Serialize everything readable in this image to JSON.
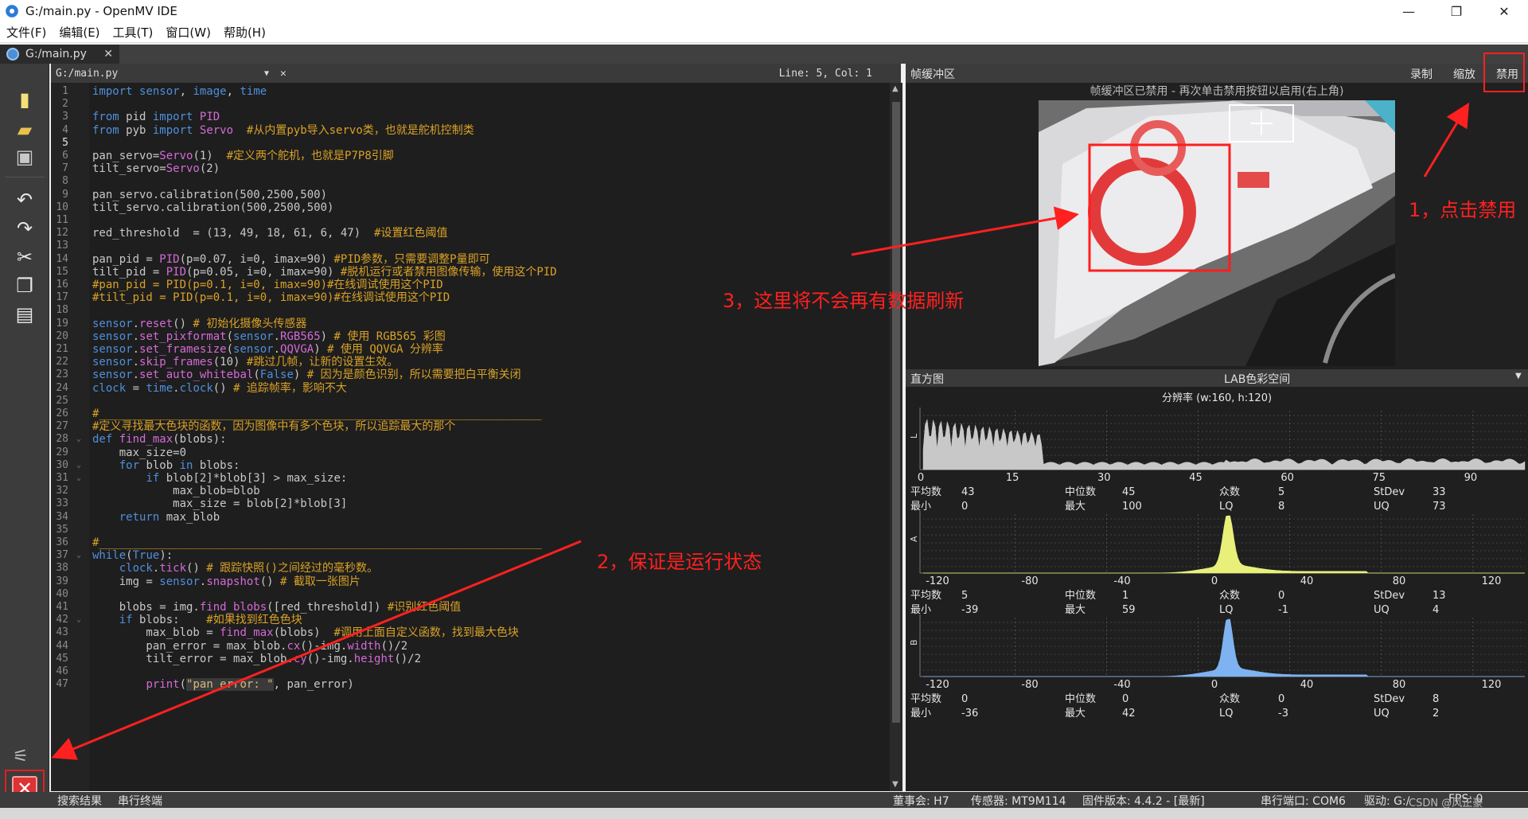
{
  "window": {
    "title": "G:/main.py - OpenMV IDE",
    "minimize": "—",
    "restore": "❐",
    "close": "✕"
  },
  "menu": [
    "文件(F)",
    "编辑(E)",
    "工具(T)",
    "窗口(W)",
    "帮助(H)"
  ],
  "tab": {
    "label": "G:/main.py"
  },
  "editor": {
    "file": "G:/main.py",
    "cursor": "Line: 5, Col: 1",
    "current_line": 5,
    "lines": [
      "import sensor, image, time",
      "",
      "from pid import PID",
      "from pyb import Servo  #从内置pyb导入servo类，也就是舵机控制类",
      "",
      "pan_servo=Servo(1)  #定义两个舵机，也就是P7P8引脚",
      "tilt_servo=Servo(2)",
      "",
      "pan_servo.calibration(500,2500,500)",
      "tilt_servo.calibration(500,2500,500)",
      "",
      "red_threshold  = (13, 49, 18, 61, 6, 47)  #设置红色阈值",
      "",
      "pan_pid = PID(p=0.07, i=0, imax=90) #PID参数，只需要调整P量即可",
      "tilt_pid = PID(p=0.05, i=0, imax=90) #脱机运行或者禁用图像传输，使用这个PID",
      "#pan_pid = PID(p=0.1, i=0, imax=90)#在线调试使用这个PID",
      "#tilt_pid = PID(p=0.1, i=0, imax=90)#在线调试使用这个PID",
      "",
      "sensor.reset() # 初始化摄像头传感器",
      "sensor.set_pixformat(sensor.RGB565) # 使用 RGB565 彩图",
      "sensor.set_framesize(sensor.QQVGA) # 使用 QQVGA 分辨率",
      "sensor.skip_frames(10) #跳过几帧，让新的设置生效。",
      "sensor.set_auto_whitebal(False) # 因为是颜色识别，所以需要把白平衡关闭",
      "clock = time.clock() # 追踪帧率，影响不大",
      "",
      "#__________________________________________________________________",
      "#定义寻找最大色块的函数，因为图像中有多个色块，所以追踪最大的那个",
      "def find_max(blobs):",
      "    max_size=0",
      "    for blob in blobs:",
      "        if blob[2]*blob[3] > max_size:",
      "            max_blob=blob",
      "            max_size = blob[2]*blob[3]",
      "    return max_blob",
      "",
      "#__________________________________________________________________",
      "while(True):",
      "    clock.tick() # 跟踪快照()之间经过的毫秒数。",
      "    img = sensor.snapshot() # 截取一张图片",
      "",
      "    blobs = img.find_blobs([red_threshold]) #识别红色阈值",
      "    if blobs:    #如果找到红色色块",
      "        max_blob = find_max(blobs)  #调用上面自定义函数，找到最大色块",
      "        pan_error = max_blob.cx()-img.width()/2",
      "        tilt_error = max_blob.cy()-img.height()/2",
      "",
      "        print(\"pan_error: \", pan_error)"
    ]
  },
  "framebuffer": {
    "label": "帧缓冲区",
    "record": "录制",
    "zoom": "缩放",
    "disable": "禁用",
    "message": "帧缓冲区已禁用 - 再次单击禁用按钮以启用(右上角)"
  },
  "histogram": {
    "label": "直方图",
    "colorspace": "LAB色彩空间",
    "resolution": "分辨率 (w:160, h:120)",
    "stat_labels": {
      "mean": "平均数",
      "median": "中位数",
      "mode": "众数",
      "stdev": "StDev",
      "min": "最小",
      "max": "最大",
      "lq": "LQ",
      "uq": "UQ"
    },
    "channels": [
      {
        "name": "L",
        "axis": [
          "0",
          "15",
          "30",
          "45",
          "60",
          "75",
          "90"
        ],
        "color": "#c8c8c8",
        "stats": {
          "mean": "43",
          "median": "45",
          "mode": "5",
          "stdev": "33",
          "min": "0",
          "max": "100",
          "lq": "8",
          "uq": "73"
        }
      },
      {
        "name": "A",
        "axis": [
          "-120",
          "-80",
          "-40",
          "0",
          "40",
          "80",
          "120"
        ],
        "color": "#e8f07a",
        "stats": {
          "mean": "5",
          "median": "1",
          "mode": "0",
          "stdev": "13",
          "min": "-39",
          "max": "59",
          "lq": "-1",
          "uq": "4"
        }
      },
      {
        "name": "B",
        "axis": [
          "-120",
          "-80",
          "-40",
          "0",
          "40",
          "80",
          "120"
        ],
        "color": "#7fb2f0",
        "stats": {
          "mean": "0",
          "median": "0",
          "mode": "0",
          "stdev": "8",
          "min": "-36",
          "max": "42",
          "lq": "-3",
          "uq": "2"
        }
      }
    ]
  },
  "status": {
    "left": [
      "搜索结果",
      "串行终端"
    ],
    "board": "董事会: H7",
    "sensor": "传感器: MT9M114",
    "firmware": "固件版本: 4.4.2 - [最新]",
    "port": "串行端口: COM6",
    "drive": "驱动: G:/",
    "fps": "FPS: 0",
    "watermark": "CSDN @风正豪"
  },
  "annotations": {
    "a1": "1，点击禁用",
    "a2": "2，保证是运行状态",
    "a3": "3，这里将不会再有数据刷新",
    "color": "#ff2020"
  }
}
